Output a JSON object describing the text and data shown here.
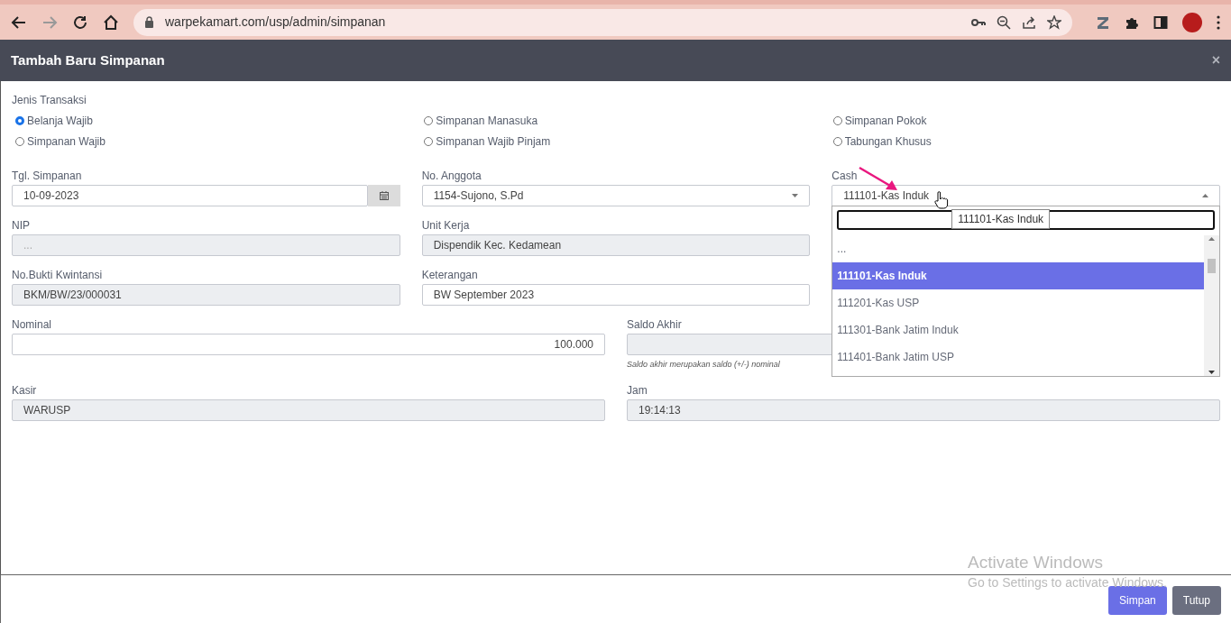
{
  "browser": {
    "url": "warpekamart.com/usp/admin/simpanan",
    "forward_disabled": true
  },
  "modal": {
    "title": "Tambah Baru Simpanan",
    "close": "×"
  },
  "transaction_type": {
    "label": "Jenis Transaksi",
    "options": [
      {
        "label": "Belanja Wajib",
        "selected": true
      },
      {
        "label": "Simpanan Manasuka",
        "selected": false
      },
      {
        "label": "Simpanan Pokok",
        "selected": false
      },
      {
        "label": "Simpanan Wajib",
        "selected": false
      },
      {
        "label": "Simpanan Wajib Pinjam",
        "selected": false
      },
      {
        "label": "Tabungan Khusus",
        "selected": false
      }
    ]
  },
  "rows": [
    {
      "kind": "three",
      "fields": [
        {
          "kind": "date",
          "label": "Tgl. Simpanan",
          "value": "10-09-2023"
        },
        {
          "kind": "select",
          "label": "No. Anggota",
          "value": "1154-Sujono, S.Pd",
          "expanded": false
        },
        {
          "kind": "select",
          "label": "Cash",
          "value": "111101-Kas Induk",
          "expanded": true,
          "tooltip": "111101-Kas Induk",
          "options": [
            {
              "label": "...",
              "selected": false
            },
            {
              "label": "111101-Kas Induk",
              "selected": true
            },
            {
              "label": "111201-Kas USP",
              "selected": false
            },
            {
              "label": "111301-Bank Jatim Induk",
              "selected": false
            },
            {
              "label": "111401-Bank Jatim USP",
              "selected": false
            }
          ]
        }
      ]
    },
    {
      "kind": "three",
      "fields": [
        {
          "kind": "readonly",
          "label": "NIP",
          "placeholder": "..."
        },
        {
          "kind": "readonly",
          "label": "Unit Kerja",
          "value": "Dispendik Kec. Kedamean"
        }
      ]
    },
    {
      "kind": "three",
      "fields": [
        {
          "kind": "readonly",
          "label": "No.Bukti Kwintansi",
          "value": "BKM/BW/23/000031"
        },
        {
          "kind": "input",
          "label": "Keterangan",
          "value": "BW September 2023"
        }
      ]
    },
    {
      "kind": "two",
      "fields": [
        {
          "kind": "number",
          "label": "Nominal",
          "value": "100.000"
        },
        {
          "kind": "readonly",
          "label": "Saldo Akhir",
          "hint": "Saldo akhir merupakan saldo (+/-) nominal"
        }
      ]
    },
    {
      "kind": "two",
      "fields": [
        {
          "kind": "readonly",
          "label": "Kasir",
          "value": "WARUSP"
        },
        {
          "kind": "readonly",
          "label": "Jam",
          "value": "19:14:13"
        }
      ]
    }
  ],
  "buttons": [
    {
      "kind": "primary",
      "label": "Simpan"
    },
    {
      "kind": "secondary",
      "label": "Tutup"
    }
  ],
  "os_notice": {
    "title": "Activate Windows",
    "text": "Go to Settings to activate Windows."
  }
}
